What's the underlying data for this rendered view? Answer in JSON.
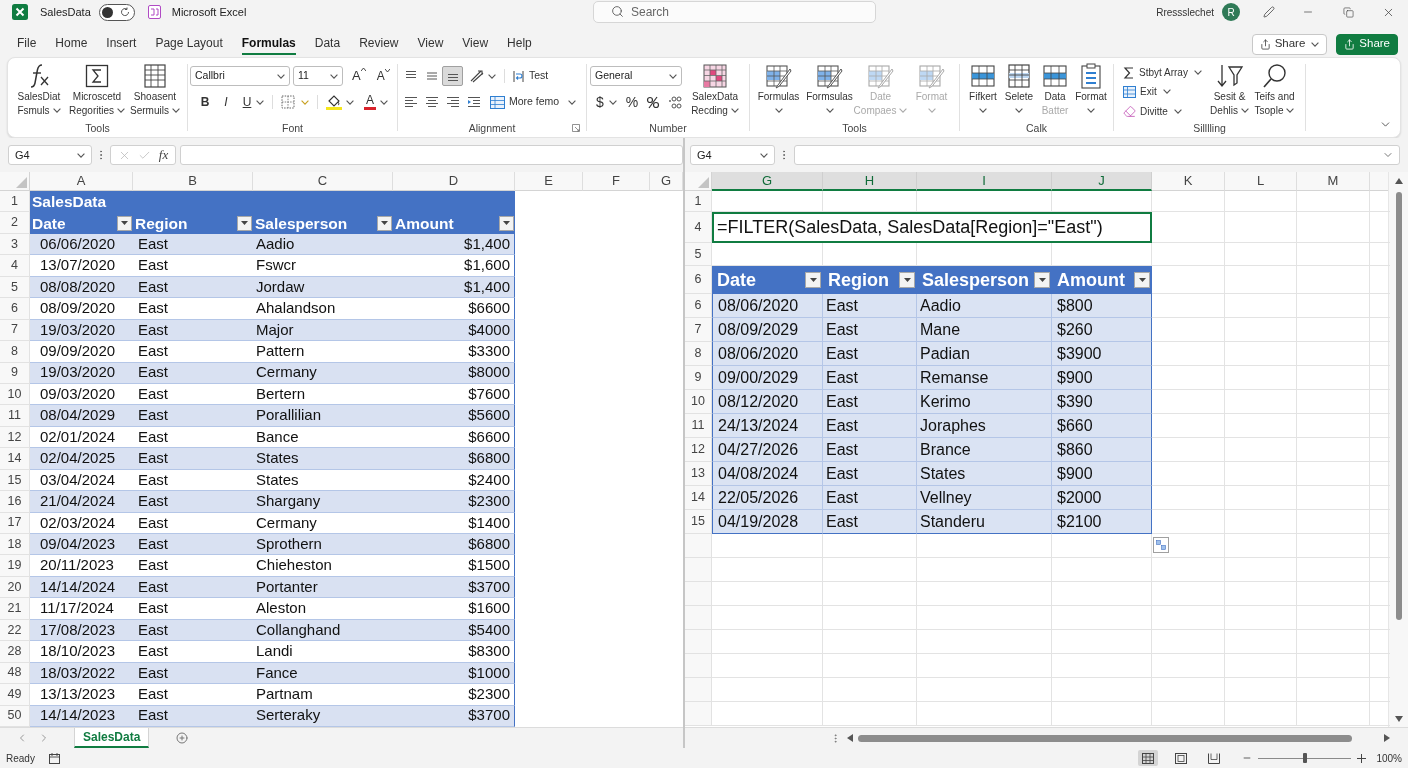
{
  "title_bar": {
    "file_name": "SalesData",
    "autosave": {
      "on": false
    },
    "app_name": "Microsoft Excel",
    "search": {
      "placeholder": "Search"
    },
    "user_name": "Rressslechet",
    "avatar_initial": "R"
  },
  "menu_tabs": [
    {
      "label": "File",
      "selected": false
    },
    {
      "label": "Home",
      "selected": false
    },
    {
      "label": "Insert",
      "selected": false
    },
    {
      "label": "Page Layout",
      "selected": false
    },
    {
      "label": "Formulas",
      "selected": true
    },
    {
      "label": "Data",
      "selected": false
    },
    {
      "label": "Review",
      "selected": false
    },
    {
      "label": "View",
      "selected": false
    },
    {
      "label": "View",
      "selected": false
    },
    {
      "label": "Help",
      "selected": false
    }
  ],
  "share_buttons": [
    {
      "label": "Share",
      "kind": "outline"
    },
    {
      "label": "Share",
      "kind": "primary"
    }
  ],
  "ribbon": {
    "tools": {
      "title": "Tools",
      "buttons": [
        {
          "lines": [
            "SalesDiat",
            "Fsmuls"
          ],
          "dropdown": true
        },
        {
          "lines": [
            "Microscetd",
            "Regorities"
          ],
          "dropdown": true
        },
        {
          "lines": [
            "Shoasent",
            "Sermuils"
          ],
          "dropdown": true
        }
      ]
    },
    "font": {
      "title": "Font",
      "font_name": "Callbri",
      "font_size": "11",
      "grow_label": "A",
      "shrink_label": "A",
      "bold_label": "B",
      "italic_label": "I",
      "underline_label": "U",
      "font_color_label": "A"
    },
    "alignment": {
      "title": "Alignment",
      "vertical_align": [
        {
          "selected": false
        },
        {
          "selected": false
        },
        {
          "selected": true
        }
      ],
      "wrap_label": "Test",
      "merge_label": "More femo"
    },
    "number": {
      "title": "Number",
      "format": "General",
      "currency_label": "$",
      "percent_label": "%",
      "record_button": {
        "lines": [
          "SalexData",
          "Recding"
        ],
        "dropdown": true
      }
    },
    "tools_2": {
      "title": "Tools",
      "buttons": [
        {
          "lines": [
            {
              "text": "Formulas",
              "disabled": false
            }
          ],
          "dropdown": true
        },
        {
          "lines": [
            {
              "text": "Formsulas",
              "disabled": false
            }
          ],
          "dropdown": true
        },
        {
          "lines": [
            {
              "text": "Date",
              "disabled": true
            },
            {
              "text": "Compaes",
              "disabled": true
            }
          ],
          "dropdown": true
        },
        {
          "lines": [
            {
              "text": "Format",
              "disabled": true
            }
          ],
          "dropdown": true
        }
      ]
    },
    "calk": {
      "title": "Calk",
      "buttons": [
        {
          "lines": [
            {
              "text": "Fifkert",
              "disabled": false
            }
          ],
          "dropdown": true
        },
        {
          "lines": [
            {
              "text": "Selete",
              "disabled": false
            }
          ],
          "dropdown": true
        },
        {
          "lines": [
            {
              "text": "Data",
              "disabled": false
            },
            {
              "text": "Batter",
              "disabled": true
            }
          ],
          "dropdown": false
        },
        {
          "lines": [
            {
              "text": "Format",
              "disabled": false
            }
          ],
          "dropdown": true
        }
      ]
    },
    "silling": {
      "title": "Silllling",
      "small_buttons": [
        {
          "label": "Stbyt Array",
          "dropdown": true
        },
        {
          "label": "Exit",
          "dropdown": true
        },
        {
          "label": "Divitte",
          "dropdown": true
        }
      ],
      "buttons": [
        {
          "lines": [
            "Sesit &",
            "Dehlis"
          ],
          "dropdown": true
        },
        {
          "lines": [
            "Teifs and",
            "Tsople"
          ],
          "dropdown": true
        }
      ]
    }
  },
  "left_window": {
    "name_box": "G4",
    "fx_label": "fx",
    "columns": [
      {
        "label": "A",
        "selected": false
      },
      {
        "label": "B",
        "selected": false
      },
      {
        "label": "C",
        "selected": false
      },
      {
        "label": "D",
        "selected": false
      },
      {
        "label": "E",
        "selected": false
      },
      {
        "label": "F",
        "selected": false
      },
      {
        "label": "G",
        "selected": false
      }
    ],
    "table": {
      "title_row": "1",
      "title": "SalesData",
      "header_row": "2",
      "headers": [
        "Date",
        "Region",
        "Salesperson",
        "Amount"
      ],
      "rows": [
        {
          "row": "3",
          "cells": [
            "06/06/2020",
            "East",
            "Aadio",
            "$1,400"
          ]
        },
        {
          "row": "4",
          "cells": [
            "13/07/2020",
            "East",
            "Fswcr",
            "$1,600"
          ]
        },
        {
          "row": "5",
          "cells": [
            "08/08/2020",
            "East",
            "Jordaw",
            "$1,400"
          ]
        },
        {
          "row": "6",
          "cells": [
            "08/09/2020",
            "East",
            "Ahalandson",
            "$6600"
          ]
        },
        {
          "row": "7",
          "cells": [
            "19/03/2020",
            "East",
            "Major",
            "$4000"
          ]
        },
        {
          "row": "8",
          "cells": [
            "09/09/2020",
            "East",
            "Pattern",
            "$3300"
          ]
        },
        {
          "row": "9",
          "cells": [
            "19/03/2020",
            "East",
            "Cermany",
            "$8000"
          ]
        },
        {
          "row": "10",
          "cells": [
            "09/03/2020",
            "East",
            "Bertern",
            "$7600"
          ]
        },
        {
          "row": "11",
          "cells": [
            "08/04/2029",
            "East",
            "Porallilian",
            "$5600"
          ]
        },
        {
          "row": "12",
          "cells": [
            "02/01/2024",
            "East",
            "Bance",
            "$6600"
          ]
        },
        {
          "row": "14",
          "cells": [
            "02/04/2025",
            "East",
            "States",
            "$6800"
          ]
        },
        {
          "row": "15",
          "cells": [
            "03/04/2024",
            "East",
            "States",
            "$2400"
          ]
        },
        {
          "row": "16",
          "cells": [
            "21/04/2024",
            "East",
            "Shargany",
            "$2300"
          ]
        },
        {
          "row": "17",
          "cells": [
            "02/03/2024",
            "East",
            "Cermany",
            "$1400"
          ]
        },
        {
          "row": "18",
          "cells": [
            "09/04/2023",
            "East",
            "Sprothern",
            "$6800"
          ]
        },
        {
          "row": "19",
          "cells": [
            "20/11/2023",
            "East",
            "Chieheston",
            "$1500"
          ]
        },
        {
          "row": "20",
          "cells": [
            "14/14/2024",
            "East",
            "Portanter",
            "$3700"
          ]
        },
        {
          "row": "21",
          "cells": [
            "11/17/2024",
            "East",
            "Aleston",
            "$1600"
          ]
        },
        {
          "row": "22",
          "cells": [
            "17/08/2023",
            "East",
            "Collanghand",
            "$5400"
          ]
        },
        {
          "row": "28",
          "cells": [
            "18/10/2023",
            "East",
            "Landi",
            "$8300"
          ]
        },
        {
          "row": "48",
          "cells": [
            "18/03/2022",
            "East",
            "Fance",
            "$1000"
          ]
        },
        {
          "row": "49",
          "cells": [
            "13/13/2023",
            "East",
            "Partnam",
            "$2300"
          ]
        },
        {
          "row": "50",
          "cells": [
            "14/14/2023",
            "East",
            "Serteraky",
            "$3700"
          ]
        }
      ]
    },
    "sheet_tabs": [
      {
        "label": "SalesData",
        "selected": true
      }
    ]
  },
  "right_window": {
    "name_box": "G4",
    "columns": [
      {
        "label": "G",
        "selected": true
      },
      {
        "label": "H",
        "selected": true
      },
      {
        "label": "I",
        "selected": true
      },
      {
        "label": "J",
        "selected": true
      },
      {
        "label": "K",
        "selected": false
      },
      {
        "label": "L",
        "selected": false
      },
      {
        "label": "M",
        "selected": false
      }
    ],
    "top_row": "1",
    "formula_row": {
      "row": "4",
      "formula": "=FILTER(SalesData, SalesData[Region]=\"East\")"
    },
    "spacer_row": "5",
    "table": {
      "header_row": "6",
      "headers": [
        "Date",
        "Region",
        "Salesperson",
        "Amount"
      ],
      "rows": [
        {
          "row": "6",
          "cells": [
            "08/06/2020",
            "East",
            "Aadio",
            "$800"
          ]
        },
        {
          "row": "7",
          "cells": [
            "08/09/2029",
            "East",
            "Mane",
            "$260"
          ]
        },
        {
          "row": "8",
          "cells": [
            "08/06/2020",
            "East",
            "Padian",
            "$3900"
          ]
        },
        {
          "row": "9",
          "cells": [
            "09/00/2029",
            "East",
            "Remanse",
            "$900"
          ]
        },
        {
          "row": "10",
          "cells": [
            "08/12/2020",
            "East",
            "Kerimo",
            "$390"
          ]
        },
        {
          "row": "11",
          "cells": [
            "24/13/2024",
            "East",
            "Joraphes",
            "$660"
          ]
        },
        {
          "row": "12",
          "cells": [
            "04/27/2026",
            "East",
            "Brance",
            "$860"
          ]
        },
        {
          "row": "13",
          "cells": [
            "04/08/2024",
            "East",
            "States",
            "$900"
          ]
        },
        {
          "row": "14",
          "cells": [
            "22/05/2026",
            "East",
            "Vellney",
            "$2000"
          ]
        },
        {
          "row": "15",
          "cells": [
            "04/19/2028",
            "East",
            "Standeru",
            "$2100"
          ]
        }
      ]
    }
  },
  "status_bar": {
    "text": "Ready",
    "views": [
      {
        "selected": true
      },
      {
        "selected": false
      },
      {
        "selected": false
      }
    ],
    "zoom": {
      "level": 0.5,
      "label": "100%"
    }
  }
}
